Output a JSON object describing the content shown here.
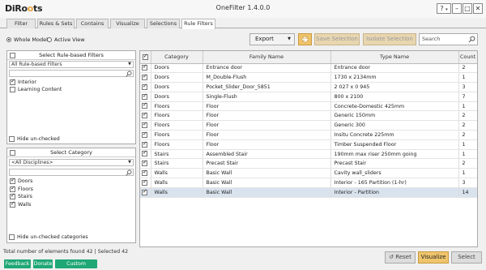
{
  "app": {
    "logo": "DiRoots",
    "title": "OneFilter 1.4.0.0",
    "help_label": "?",
    "window_buttons": {
      "minimize": "–",
      "maximize": "□",
      "close": "✕"
    }
  },
  "tabs": [
    {
      "label": "Filter",
      "active": false
    },
    {
      "label": "Rules & Sets",
      "active": false
    },
    {
      "label": "Contains",
      "active": false
    },
    {
      "label": "Visualize",
      "active": false
    },
    {
      "label": "Selections",
      "active": false
    },
    {
      "label": "Rule Filters",
      "active": true
    }
  ],
  "scope": {
    "whole_model": "Whole Model",
    "active_view": "Active View",
    "selected": "Whole Model"
  },
  "toolbar": {
    "export_label": "Export",
    "save_selection": "Save Selection",
    "isolate_selection": "Isolate Selection",
    "search_placeholder": "Search"
  },
  "rule_panel": {
    "header": "Select Rule-based Filters",
    "dropdown_value": "All Rule-based Filters",
    "items": [
      {
        "label": "Interior",
        "checked": true
      },
      {
        "label": "Learning Content",
        "checked": false
      }
    ],
    "hide_unchecked": "Hide un-checked"
  },
  "category_panel": {
    "header": "Select Category",
    "dropdown_value": "<All Disciplines>",
    "items": [
      {
        "label": "Doors",
        "checked": true
      },
      {
        "label": "Floors",
        "checked": true
      },
      {
        "label": "Stairs",
        "checked": true
      },
      {
        "label": "Walls",
        "checked": true
      }
    ],
    "hide_unchecked": "Hide un-checked categories"
  },
  "grid": {
    "columns": [
      "Category",
      "Family Name",
      "Type Name",
      "Count"
    ],
    "rows": [
      {
        "category": "Doors",
        "family": "Entrance door",
        "type": "Entrance door",
        "count": "2"
      },
      {
        "category": "Doors",
        "family": "M_Double-Flush",
        "type": "1730 x 2134mm",
        "count": "1"
      },
      {
        "category": "Doors",
        "family": "Pocket_Slider_Door_5851",
        "type": "2 027 x 0 945",
        "count": "3"
      },
      {
        "category": "Doors",
        "family": "Single-Flush",
        "type": "800 x 2100",
        "count": "7"
      },
      {
        "category": "Floors",
        "family": "Floor",
        "type": "Concrete-Domestic 425mm",
        "count": "1"
      },
      {
        "category": "Floors",
        "family": "Floor",
        "type": "Generic 150mm",
        "count": "2"
      },
      {
        "category": "Floors",
        "family": "Floor",
        "type": "Generic 300",
        "count": "2"
      },
      {
        "category": "Floors",
        "family": "Floor",
        "type": "Insitu Concrete 225mm",
        "count": "2"
      },
      {
        "category": "Floors",
        "family": "Floor",
        "type": "Timber Suspended Floor",
        "count": "1"
      },
      {
        "category": "Stairs",
        "family": "Assembled Stair",
        "type": "190mm max riser 250mm going",
        "count": "1"
      },
      {
        "category": "Stairs",
        "family": "Precast Stair",
        "type": "Precast Stair",
        "count": "2"
      },
      {
        "category": "Walls",
        "family": "Basic Wall",
        "type": "Cavity wall_sliders",
        "count": "1"
      },
      {
        "category": "Walls",
        "family": "Basic Wall",
        "type": "Interior - 165 Partition (1-hr)",
        "count": "3"
      },
      {
        "category": "Walls",
        "family": "Basic Wall",
        "type": "Interior - Partition",
        "count": "14",
        "selected": true
      }
    ]
  },
  "status": "Total number of elements found 42 | Selected 42",
  "footer": {
    "feedback": "Feedback",
    "donate": "Donate",
    "custom_software": "Custom Software",
    "reset": "Reset",
    "visualize": "Visualize",
    "select": "Select"
  },
  "colors": {
    "accent_orange": "#efc46c",
    "accent_green": "#1fa776",
    "selected_row": "#d9e3ee"
  }
}
